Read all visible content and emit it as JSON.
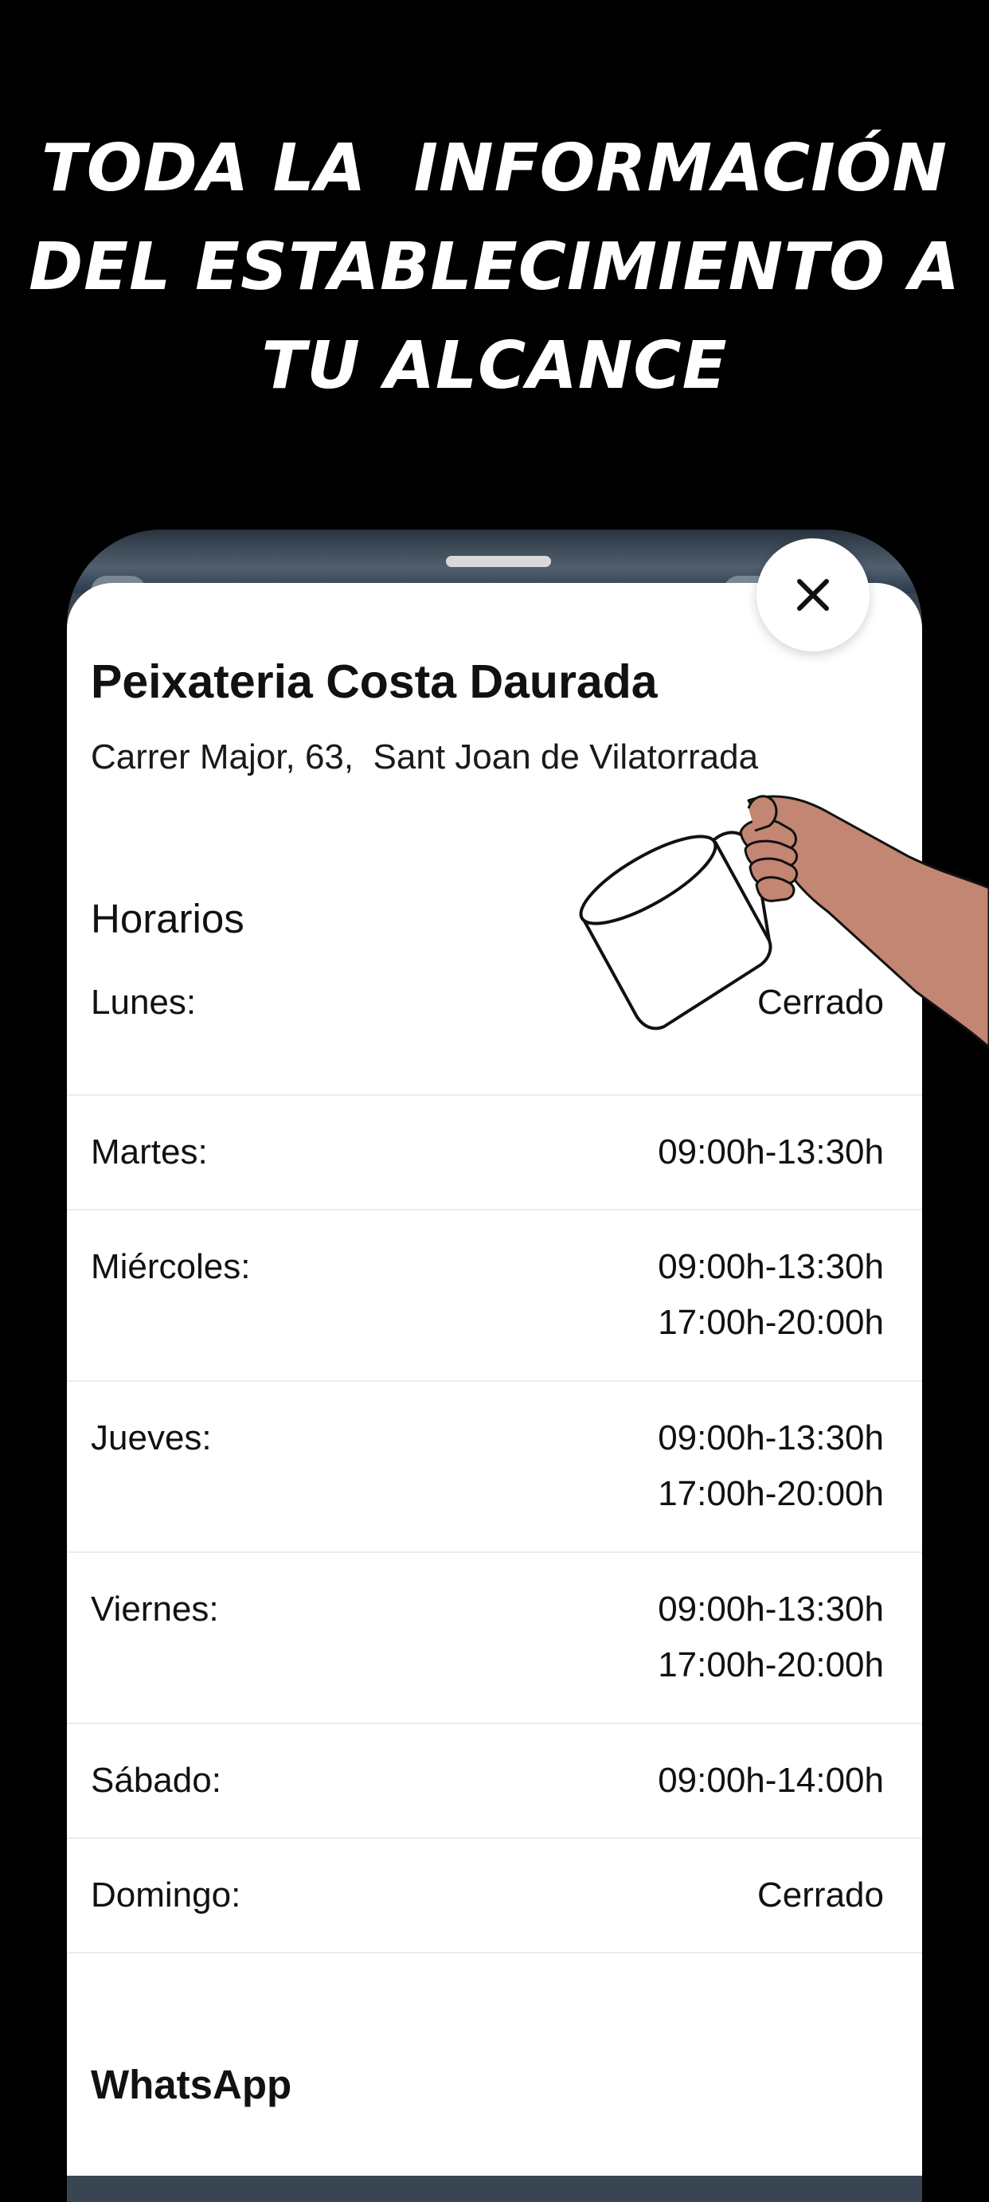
{
  "headline": {
    "line1": "TODA LA  INFORMACIÓN",
    "line2": "DEL ESTABLECIMIENTO A",
    "line3": "TU ALCANCE"
  },
  "store": {
    "name": "Peixateria Costa Daurada",
    "address": "Carrer Major, 63,  Sant Joan de Vilatorrada"
  },
  "hours": {
    "title": "Horarios",
    "days": [
      {
        "day": "Lunes:",
        "times": [
          "Cerrado"
        ]
      },
      {
        "day": "Martes:",
        "times": [
          "09:00h-13:30h"
        ]
      },
      {
        "day": "Miércoles:",
        "times": [
          "09:00h-13:30h",
          "17:00h-20:00h"
        ]
      },
      {
        "day": "Jueves:",
        "times": [
          "09:00h-13:30h",
          "17:00h-20:00h"
        ]
      },
      {
        "day": "Viernes:",
        "times": [
          "09:00h-13:30h",
          "17:00h-20:00h"
        ]
      },
      {
        "day": "Sábado:",
        "times": [
          "09:00h-14:00h"
        ]
      },
      {
        "day": "Domingo:",
        "times": [
          "Cerrado"
        ]
      }
    ]
  },
  "whatsapp": {
    "title": "WhatsApp"
  },
  "icons": {
    "close": "close-icon",
    "illustration": "hand-pouring-jug-illustration"
  },
  "colors": {
    "background": "#000000",
    "sheet": "#ffffff",
    "text": "#111111",
    "divider": "#ececec",
    "skin": "#c38673"
  }
}
